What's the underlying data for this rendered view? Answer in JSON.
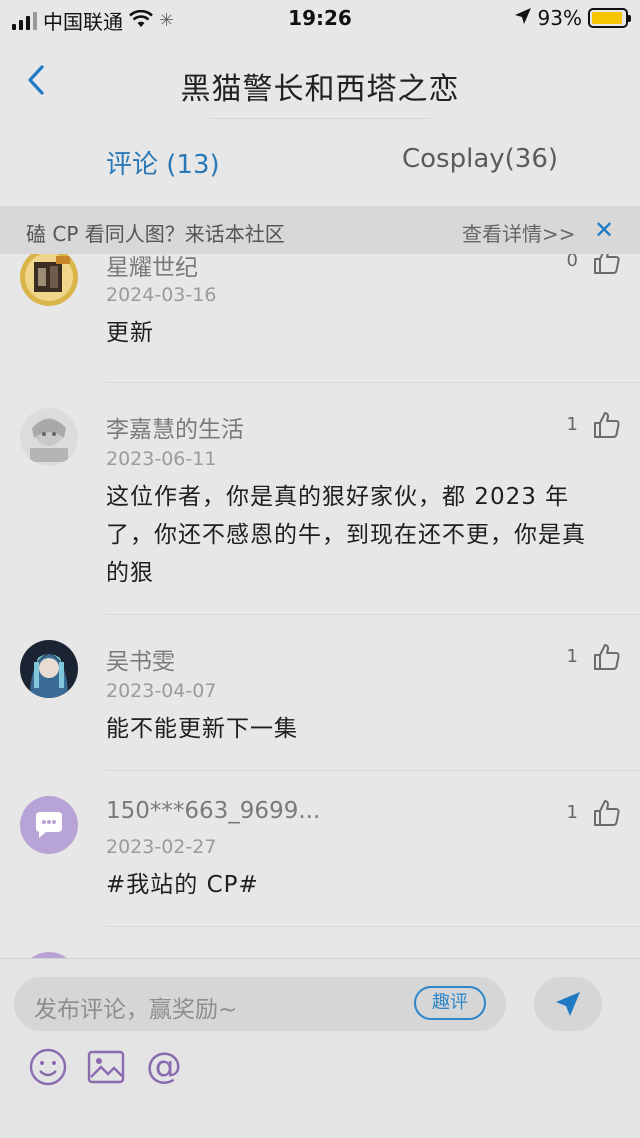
{
  "status_bar": {
    "carrier": "中国联通",
    "time": "19:26",
    "battery": "93%",
    "battery_level": 0.93
  },
  "nav": {
    "title": "黑猫警长和西塔之恋",
    "back_icon": "chevron-left-icon"
  },
  "tabs": [
    {
      "label": "评论 (13)",
      "active": true
    },
    {
      "label": "Cosplay(36)",
      "active": false
    }
  ],
  "banner": {
    "text": "磕 CP 看同人图？来话本社区",
    "link": "查看详情>>",
    "close_icon": "close-icon"
  },
  "comments": [
    {
      "name": "星耀世纪",
      "date": "2024-03-16",
      "text": "更新",
      "likes": "0"
    },
    {
      "name": "李嘉慧的生活",
      "date": "2023-06-11",
      "text": "这位作者，你是真的狠好家伙，都 2023 年了，你还不感恩的牛，到现在还不更，你是真的狠",
      "likes": "1"
    },
    {
      "name": "吴书雯",
      "date": "2023-04-07",
      "text": "能不能更新下一集",
      "likes": "1"
    },
    {
      "name": "150***663_9699...",
      "date": "2023-02-27",
      "text": "#我站的 CP#",
      "likes": "1"
    }
  ],
  "composer": {
    "placeholder": "发布评论，赢奖励~",
    "quick_label": "趣评",
    "at_symbol": "@"
  },
  "colors": {
    "accent": "#2a79b6",
    "tool": "#8a6bb0"
  }
}
